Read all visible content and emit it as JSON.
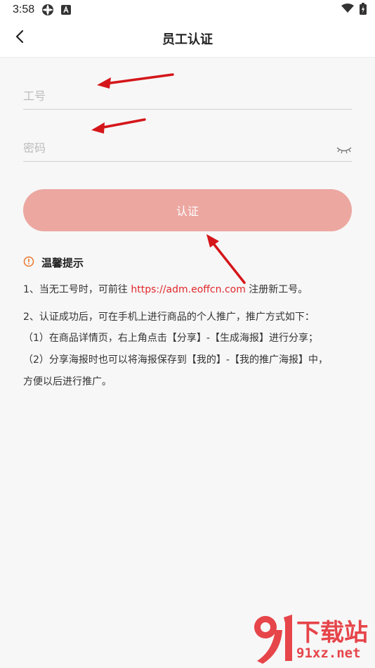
{
  "status_bar": {
    "time": "3:58",
    "icons": [
      "settings-icon",
      "font-a-icon",
      "wifi-icon",
      "battery-icon"
    ]
  },
  "nav": {
    "title": "员工认证",
    "back_icon": "chevron-left-icon"
  },
  "form": {
    "employee_id": {
      "placeholder": "工号",
      "value": ""
    },
    "password": {
      "placeholder": "密码",
      "value": "",
      "toggle_icon": "eye-closed-icon"
    },
    "submit_label": "认证"
  },
  "tips": {
    "icon": "info-circle-icon",
    "title": "温馨提示",
    "line1_prefix": "1、当无工号时，可前往 ",
    "line1_link": "https://adm.eoffcn.com",
    "line1_suffix": " 注册新工号。",
    "line2": "2、认证成功后，可在手机上进行商品的个人推广，推广方式如下：",
    "line3": "（1）在商品详情页，右上角点击【分享】-【生成海报】进行分享；",
    "line4": "（2）分享海报时也可以将海报保存到【我的】-【我的推广海报】中，",
    "line5": "方便以后进行推广。"
  },
  "watermark": {
    "text_main": "下载站",
    "text_sub": "91xz.net"
  },
  "colors": {
    "accent": "#eca7a1",
    "link": "#e0282b",
    "tip_icon": "#e8772e",
    "annotation_arrow": "#d4161a",
    "background": "#f7f7f7"
  }
}
